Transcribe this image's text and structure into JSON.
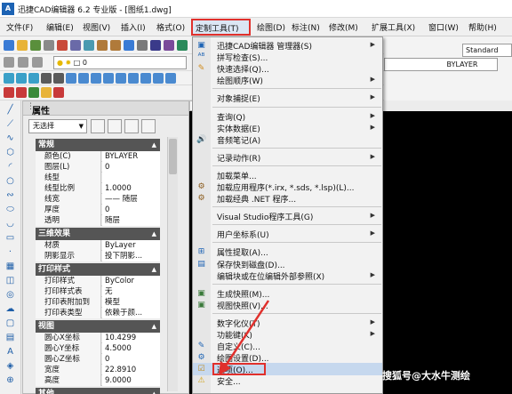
{
  "window": {
    "title": "迅捷CAD编辑器 6.2 专业版 - [图纸1.dwg]",
    "logo_text": "A"
  },
  "menubar": {
    "items": [
      "文件(F)",
      "编辑(E)",
      "视图(V)",
      "插入(I)",
      "格式(O)",
      "定制工具(T)",
      "绘图(D)",
      "标注(N)",
      "修改(M)",
      "扩展工具(X)",
      "窗口(W)",
      "帮助(H)"
    ],
    "active": "定制工具(T)"
  },
  "toolbars": {
    "color_value": "0",
    "linetype_value": "BYLAYER",
    "textstyle_value": "Standard"
  },
  "properties": {
    "title": "属性",
    "selection": "无选择",
    "sections": [
      {
        "name": "常规",
        "rows": [
          [
            "颜色(C)",
            "BYLAYER"
          ],
          [
            "图层(L)",
            "0"
          ],
          [
            "线型",
            ""
          ],
          [
            "线型比例",
            "1.0000"
          ],
          [
            "线宽",
            "—— 随层"
          ],
          [
            "厚度",
            "0"
          ],
          [
            "透明",
            "随层"
          ]
        ]
      },
      {
        "name": "三维效果",
        "rows": [
          [
            "材质",
            "ByLayer"
          ],
          [
            "阴影显示",
            "投下阴影..."
          ]
        ]
      },
      {
        "name": "打印样式",
        "rows": [
          [
            "打印样式",
            "ByColor"
          ],
          [
            "打印样式表",
            "无"
          ],
          [
            "打印表附加到",
            "模型"
          ],
          [
            "打印表类型",
            "依赖于颜..."
          ]
        ]
      },
      {
        "name": "视图",
        "rows": [
          [
            "圆心X坐标",
            "10.4299"
          ],
          [
            "圆心Y坐标",
            "4.5000"
          ],
          [
            "圆心Z坐标",
            "0"
          ],
          [
            "宽度",
            "22.8910"
          ],
          [
            "高度",
            "9.0000"
          ]
        ]
      },
      {
        "name": "其他",
        "rows": []
      }
    ]
  },
  "dropdown": {
    "items": [
      {
        "label": "迅捷CAD编辑器 管理器(S)",
        "icon": "app-icon",
        "arrow": true
      },
      {
        "label": "拼写检查(S)...",
        "icon": "spell-icon",
        "arrow": false
      },
      {
        "label": "快速选择(Q)...",
        "icon": "quick-select-icon",
        "arrow": false
      },
      {
        "label": "绘图顺序(W)",
        "icon": "",
        "arrow": true
      },
      {
        "sep": true
      },
      {
        "label": "对象捕捉(E)",
        "icon": "",
        "arrow": true
      },
      {
        "sep": true
      },
      {
        "label": "查询(Q)",
        "icon": "",
        "arrow": true
      },
      {
        "label": "实体数据(E)",
        "icon": "",
        "arrow": true
      },
      {
        "label": "音频笔记(A)",
        "icon": "audio-icon",
        "arrow": false
      },
      {
        "sep": true
      },
      {
        "label": "记录动作(R)",
        "icon": "",
        "arrow": true
      },
      {
        "sep": true
      },
      {
        "label": "加载菜单...",
        "icon": "",
        "arrow": false
      },
      {
        "label": "加载应用程序(*.irx, *.sds, *.lsp)(L)...",
        "icon": "load-app-icon",
        "arrow": false
      },
      {
        "label": "加载经典 .NET 程序...",
        "icon": "dotnet-icon",
        "arrow": false
      },
      {
        "sep": true
      },
      {
        "label": "Visual Studio程序工具(G)",
        "icon": "",
        "arrow": true
      },
      {
        "sep": true
      },
      {
        "label": "用户坐标系(U)",
        "icon": "",
        "arrow": true
      },
      {
        "sep": true
      },
      {
        "label": "属性提取(A)...",
        "icon": "extract-icon",
        "arrow": false
      },
      {
        "label": "保存快到磁盘(D)...",
        "icon": "save-disk-icon",
        "arrow": false
      },
      {
        "label": "编辑块或在位编辑外部参照(X)",
        "icon": "",
        "arrow": true
      },
      {
        "sep": true
      },
      {
        "label": "生成快照(M)...",
        "icon": "snapshot-icon",
        "arrow": false
      },
      {
        "label": "视图快照(V)...",
        "icon": "view-snapshot-icon",
        "arrow": false
      },
      {
        "sep": true
      },
      {
        "label": "数字化仪(T)",
        "icon": "",
        "arrow": true
      },
      {
        "label": "功能键(K)",
        "icon": "",
        "arrow": true
      },
      {
        "label": "自定义(C)...",
        "icon": "customize-icon",
        "arrow": false
      },
      {
        "label": "绘图设置(D)...",
        "icon": "settings-icon",
        "arrow": false
      },
      {
        "label": "选项(O)...",
        "icon": "options-icon",
        "arrow": false,
        "highlight": true
      },
      {
        "label": "安全...",
        "icon": "warning-icon",
        "arrow": false
      }
    ]
  },
  "watermark": "搜狐号@大水牛测绘"
}
